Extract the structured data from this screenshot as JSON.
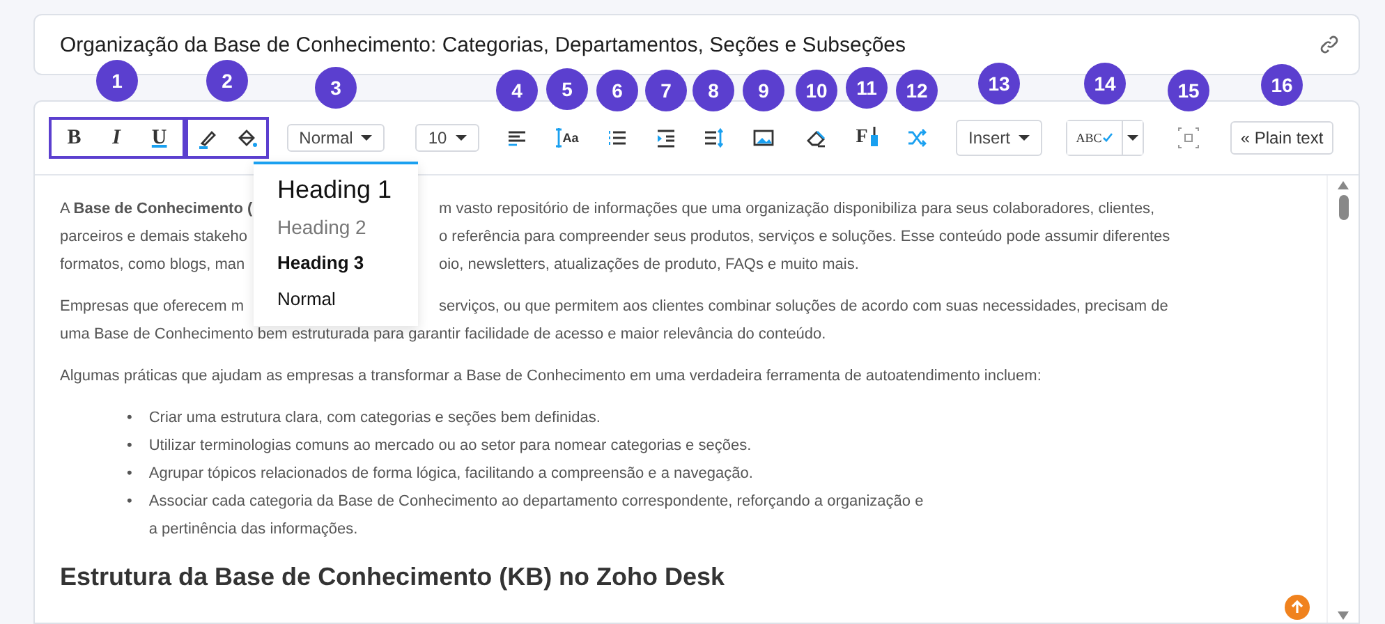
{
  "title_field": {
    "value": "Organização da Base de Conhecimento: Categorias, Departamentos, Seções e Subseções"
  },
  "toolbar": [
    {
      "badge": "1",
      "labels": [
        "B",
        "I",
        "U"
      ]
    },
    {
      "badge": "2"
    },
    {
      "badge": "3",
      "label": "Normal"
    },
    {
      "label": "10"
    },
    {
      "badge": "4"
    },
    {
      "badge": "5",
      "label": "Aa"
    },
    {
      "badge": "6"
    },
    {
      "badge": "7"
    },
    {
      "badge": "8"
    },
    {
      "badge": "9"
    },
    {
      "badge": "10"
    },
    {
      "badge": "11",
      "label": "F"
    },
    {
      "badge": "12"
    },
    {
      "badge": "13",
      "label": "Insert"
    },
    {
      "badge": "14",
      "label": "ABC"
    },
    {
      "badge": "15"
    },
    {
      "badge": "16",
      "label": "« Plain text"
    }
  ],
  "format_menu": {
    "items": [
      {
        "label": "Heading 1",
        "kind": "h1"
      },
      {
        "label": "Heading 2",
        "kind": "h2"
      },
      {
        "label": "Heading 3",
        "kind": "h3"
      },
      {
        "label": "Normal",
        "kind": "normal"
      }
    ]
  },
  "content": [
    {
      "kind": "paragraph",
      "lines": [
        {
          "left": "A **Base de Conhecimento (**",
          "right": "m vasto repositório de informações que uma organização disponibiliza para seus colaboradores, clientes,"
        },
        {
          "left": "parceiros e demais stakeho",
          "right": "o referência para compreender seus produtos, serviços e soluções. Esse conteúdo pode assumir diferentes"
        },
        {
          "left": "formatos, como blogs, man",
          "right": "oio, newsletters, atualizações de produto, FAQs e muito mais."
        }
      ]
    },
    {
      "kind": "paragraph",
      "lines": [
        {
          "left": "Empresas que oferecem m",
          "right": "serviços, ou que permitem aos clientes combinar soluções de acordo com suas necessidades, precisam de"
        },
        {
          "text": "uma Base de Conhecimento bem estruturada para garantir facilidade de acesso e maior relevância do conteúdo."
        }
      ]
    },
    {
      "kind": "paragraph",
      "lines": [
        {
          "text": "Algumas práticas que ajudam as empresas a transformar a Base de Conhecimento em uma verdadeira ferramenta de autoatendimento incluem:"
        }
      ]
    },
    {
      "kind": "list",
      "marker": "•",
      "items": [
        "Criar uma estrutura clara, com categorias e seções bem definidas.",
        "Utilizar terminologias comuns ao mercado ou ao setor para nomear categorias e seções.",
        "Agrupar tópicos relacionados de forma lógica, facilitando a compreensão e a navegação.",
        "Associar cada categoria da Base de Conhecimento ao departamento correspondente, reforçando a organização e a pertinência das informações."
      ]
    },
    {
      "kind": "heading",
      "text": "Estrutura da Base de Conhecimento (KB) no Zoho Desk"
    }
  ]
}
